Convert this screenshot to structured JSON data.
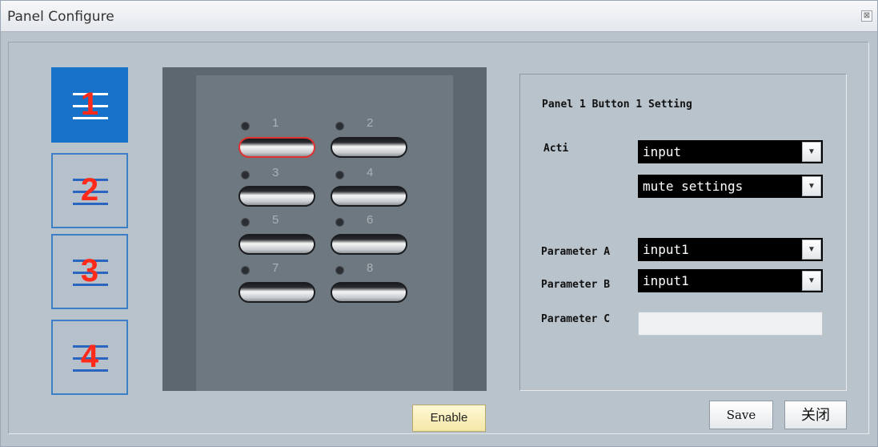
{
  "window": {
    "title": "Panel Configure",
    "close_glyph": "⊠"
  },
  "panel_buttons": [
    {
      "label": "1",
      "active": true
    },
    {
      "label": "2",
      "active": false
    },
    {
      "label": "3",
      "active": false
    },
    {
      "label": "4",
      "active": false
    }
  ],
  "device": {
    "keys": [
      {
        "label": "1",
        "selected": true
      },
      {
        "label": "2",
        "selected": false
      },
      {
        "label": "3",
        "selected": false
      },
      {
        "label": "4",
        "selected": false
      },
      {
        "label": "5",
        "selected": false
      },
      {
        "label": "6",
        "selected": false
      },
      {
        "label": "7",
        "selected": false
      },
      {
        "label": "8",
        "selected": false
      }
    ],
    "enable_label": "Enable"
  },
  "settings": {
    "title": "Panel 1 Button 1 Setting",
    "action_label": "Acti",
    "action_value": "input",
    "action_sub_value": "mute settings",
    "param_a_label": "Parameter A",
    "param_a_value": "input1",
    "param_b_label": "Parameter B",
    "param_b_value": "input1",
    "param_c_label": "Parameter C",
    "param_c_value": ""
  },
  "footer": {
    "save_label": "Save",
    "close_label": "关闭"
  },
  "colors": {
    "accent": "#1673c9",
    "number": "#ff2a1a",
    "selected_key": "#e03030"
  }
}
